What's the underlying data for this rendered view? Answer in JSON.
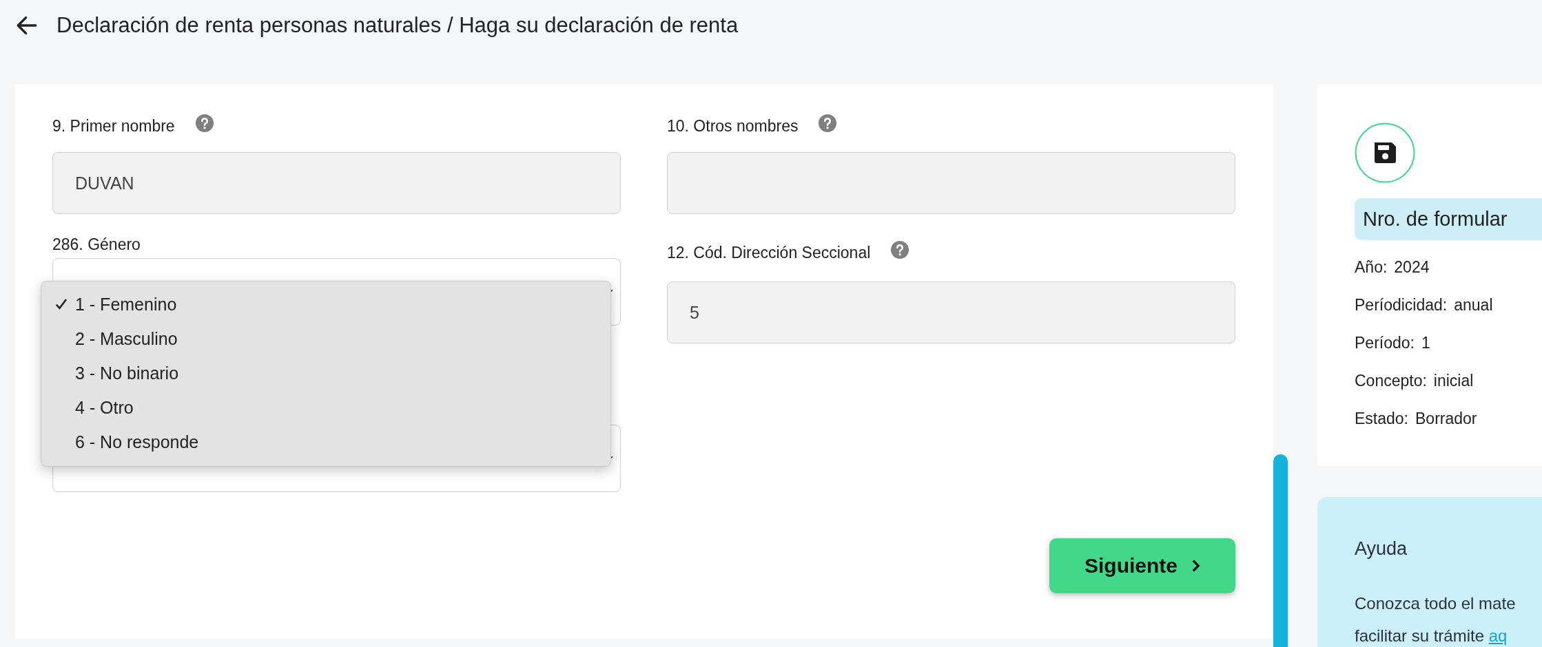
{
  "header": {
    "title": "Declaración de renta personas naturales / Haga su declaración de renta"
  },
  "form": {
    "left": [
      {
        "kind": "text",
        "label": "9. Primer nombre",
        "help": true,
        "value": "DUVAN"
      },
      {
        "kind": "select",
        "label": "286. Género",
        "help": false
      },
      {
        "kind": "select"
      }
    ],
    "right": [
      {
        "kind": "text",
        "label": "10. Otros nombres",
        "help": true
      },
      {
        "kind": "text",
        "label": "12. Cód. Dirección Seccional",
        "help": true,
        "value": "5"
      }
    ],
    "dropdown": [
      {
        "label": "1 - Femenino",
        "selected": true
      },
      {
        "label": "2 - Masculino",
        "selected": false
      },
      {
        "label": "3 - No binario",
        "selected": false
      },
      {
        "label": "4 - Otro",
        "selected": false
      },
      {
        "label": "6 - No responde",
        "selected": false
      }
    ],
    "next_button": "Siguiente"
  },
  "summary": {
    "form_number": "Nro. de formular",
    "info": [
      {
        "label": "Año:",
        "value": "2024"
      },
      {
        "label": "Períodicidad:",
        "value": "anual"
      },
      {
        "label": "Período:",
        "value": "1"
      },
      {
        "label": "Concepto:",
        "value": "inicial"
      },
      {
        "label": "Estado:",
        "value": "Borrador"
      }
    ]
  },
  "help": {
    "title": "Ayuda",
    "lines": [
      "Conozca todo el mate",
      "facilitar su trámite"
    ],
    "link": "aq"
  }
}
